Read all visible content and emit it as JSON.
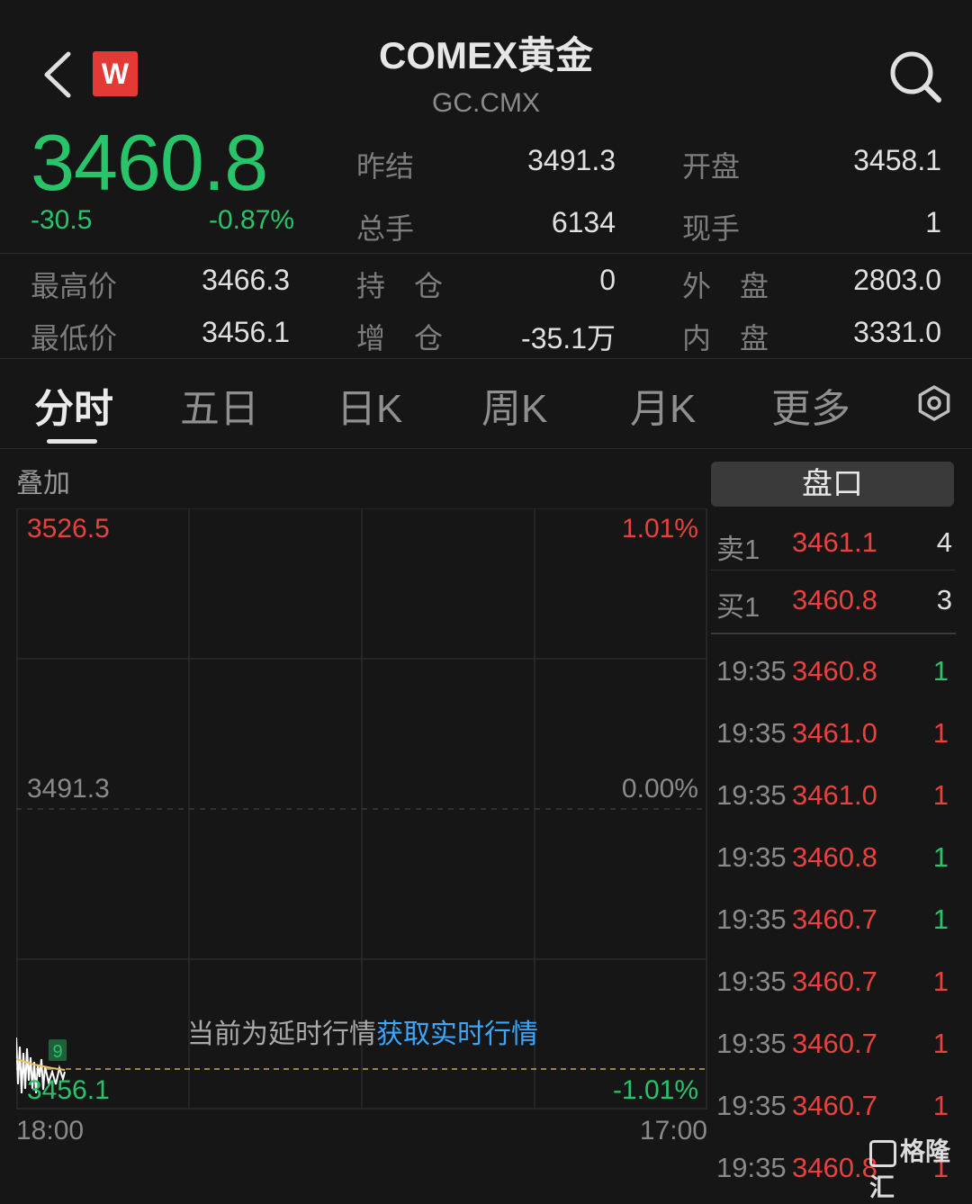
{
  "header": {
    "title": "COMEX黄金",
    "code": "GC.CMX",
    "logo_letter": "W"
  },
  "quote": {
    "price": "3460.8",
    "change": "-30.5",
    "change_pct": "-0.87%",
    "color_down": "#27c46a",
    "color_up": "#e8413e",
    "stats_top": [
      {
        "label": "昨结",
        "value": "3491.3"
      },
      {
        "label": "开盘",
        "value": "3458.1"
      },
      {
        "label": "总手",
        "value": "6134"
      },
      {
        "label": "现手",
        "value": "1"
      }
    ],
    "stats_bottom": [
      {
        "label": "最高价",
        "value": "3466.3"
      },
      {
        "label": "持　仓",
        "value": "0"
      },
      {
        "label": "外　盘",
        "value": "2803.0"
      },
      {
        "label": "最低价",
        "value": "3456.1"
      },
      {
        "label": "增　仓",
        "value": "-35.1万"
      },
      {
        "label": "内　盘",
        "value": "3331.0"
      }
    ]
  },
  "tabs": [
    "分时",
    "五日",
    "日K",
    "周K",
    "月K",
    "更多"
  ],
  "chart": {
    "overlay_label": "叠加",
    "top_price": "3526.5",
    "top_pct": "1.01%",
    "mid_price": "3491.3",
    "mid_pct": "0.00%",
    "bottom_price": "3456.1",
    "bottom_pct": "-1.01%",
    "x_start": "18:00",
    "x_end": "17:00",
    "volume_badge": "9",
    "delay_notice": "当前为延时行情",
    "delay_link": "获取实时行情"
  },
  "order_book": {
    "title": "盘口",
    "sell": {
      "label": "卖1",
      "price": "3461.1",
      "qty": "4"
    },
    "buy": {
      "label": "买1",
      "price": "3460.8",
      "qty": "3"
    }
  },
  "ticks": [
    {
      "time": "19:35",
      "price": "3460.8",
      "qty": "1",
      "side": "buy"
    },
    {
      "time": "19:35",
      "price": "3461.0",
      "qty": "1",
      "side": "sell"
    },
    {
      "time": "19:35",
      "price": "3461.0",
      "qty": "1",
      "side": "sell"
    },
    {
      "time": "19:35",
      "price": "3460.8",
      "qty": "1",
      "side": "buy"
    },
    {
      "time": "19:35",
      "price": "3460.7",
      "qty": "1",
      "side": "buy"
    },
    {
      "time": "19:35",
      "price": "3460.7",
      "qty": "1",
      "side": "sell"
    },
    {
      "time": "19:35",
      "price": "3460.7",
      "qty": "1",
      "side": "sell"
    },
    {
      "time": "19:35",
      "price": "3460.7",
      "qty": "1",
      "side": "sell"
    },
    {
      "time": "19:35",
      "price": "3460.8",
      "qty": "1",
      "side": "sell"
    }
  ],
  "watermark": "格隆汇"
}
